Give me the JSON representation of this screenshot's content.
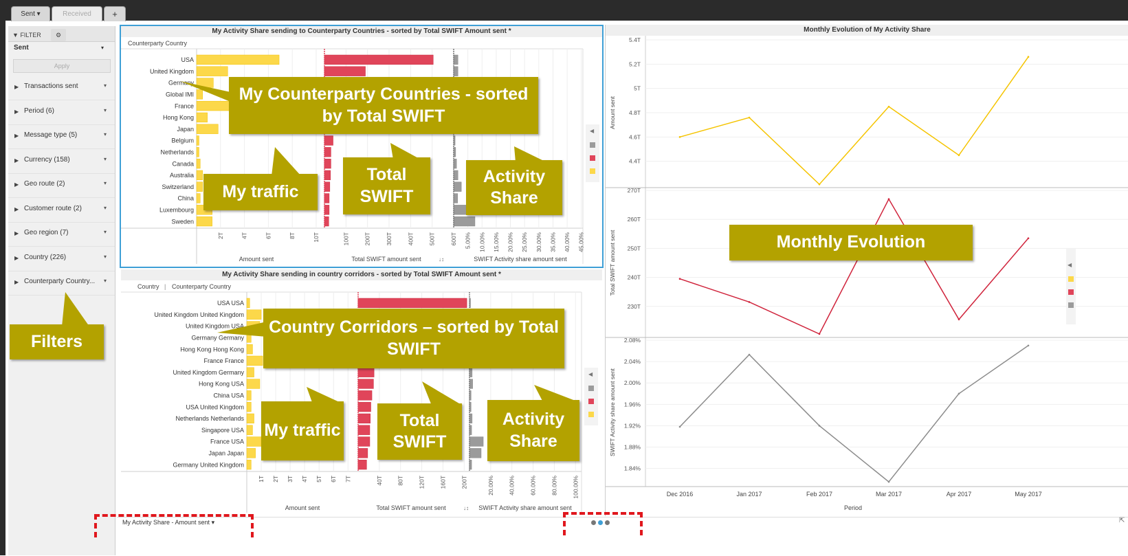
{
  "tabs": [
    {
      "label": "Sent",
      "active": true
    },
    {
      "label": "Received",
      "active": false
    }
  ],
  "add_tab_label": "+",
  "filter_panel": {
    "tab_label": "FILTER",
    "selection": "Sent",
    "apply_label": "Apply",
    "items": [
      {
        "label": "Transactions sent"
      },
      {
        "label": "Period (6)"
      },
      {
        "label": "Message type (5)"
      },
      {
        "label": "Currency (158)"
      },
      {
        "label": "Geo route (2)"
      },
      {
        "label": "Customer route (2)"
      },
      {
        "label": "Geo region (7)"
      },
      {
        "label": "Country (226)"
      },
      {
        "label": "Counterparty Country..."
      }
    ]
  },
  "colors": {
    "traffic": "#fcd84a",
    "swift": "#e0455a",
    "share": "#9b9b9b",
    "callout": "#b3a200",
    "selection_border": "#3e9fd6"
  },
  "panel_top": {
    "title": "My Activity Share sending to Counterparty Countries - sorted by Total SWIFT Amount sent *",
    "dimension_header": "Counterparty Country",
    "axis_labels": {
      "traffic": "Amount sent",
      "swift": "Total SWIFT amount sent",
      "sort_icon": "↓↕",
      "share": "SWIFT Activity share amount sent"
    }
  },
  "panel_bottom": {
    "title": "My Activity Share sending in country corridors - sorted by Total SWIFT Amount sent *",
    "dimension_header_1": "Country",
    "dimension_sep": "|",
    "dimension_header_2": "Counterparty Country",
    "axis_labels": {
      "traffic": "Amount sent",
      "swift": "Total SWIFT amount sent",
      "sort_icon": "↓↕",
      "share": "SWIFT Activity share amount sent"
    }
  },
  "panel_right": {
    "title": "Monthly Evolution of My Activity Share",
    "xlabel": "Period"
  },
  "chart_data": [
    {
      "type": "bar",
      "categories": [
        "USA",
        "United Kingdom",
        "Germany",
        "Global IMI",
        "France",
        "Hong Kong",
        "Japan",
        "Belgium",
        "Netherlands",
        "Canada",
        "Australia",
        "Switzerland",
        "China",
        "Luxembourg",
        "Sweden"
      ],
      "series": [
        {
          "name": "Amount sent",
          "values": [
            6.9,
            2.6,
            1.4,
            0.5,
            2.9,
            0.9,
            1.8,
            0.2,
            0.2,
            0.3,
            0.5,
            0.5,
            0.3,
            1.3,
            1.3
          ]
        },
        {
          "name": "Total SWIFT amount sent",
          "values": [
            505,
            190,
            150,
            130,
            115,
            100,
            90,
            40,
            30,
            30,
            28,
            25,
            22,
            22,
            20
          ]
        },
        {
          "name": "SWIFT Activity share amount sent",
          "values": [
            1.5,
            1.5,
            1.2,
            0.5,
            2.2,
            1.0,
            2.2,
            0.5,
            0.7,
            1.0,
            1.5,
            2.7,
            1.4,
            7.5,
            7.5
          ]
        }
      ],
      "traffic_ticks": [
        "2T",
        "4T",
        "6T",
        "8T",
        "10T"
      ],
      "swift_ticks": [
        "100T",
        "200T",
        "300T",
        "400T",
        "500T",
        "600T"
      ],
      "share_ticks": [
        "5.00%",
        "10.00%",
        "15.00%",
        "20.00%",
        "25.00%",
        "30.00%",
        "35.00%",
        "40.00%",
        "45.00%"
      ],
      "xlim": {
        "traffic": [
          0,
          10
        ],
        "swift": [
          0,
          600
        ],
        "share": [
          0,
          47
        ]
      }
    },
    {
      "type": "bar",
      "categories": [
        "USA USA",
        "United Kingdom United Kingdom",
        "United Kingdom USA",
        "Germany Germany",
        "Hong Kong Hong Kong",
        "France France",
        "United Kingdom Germany",
        "Hong Kong USA",
        "China USA",
        "USA United Kingdom",
        "Netherlands Netherlands",
        "Singapore USA",
        "France USA",
        "Japan Japan",
        "Germany United Kingdom"
      ],
      "series": [
        {
          "name": "Amount sent",
          "values": [
            0.2,
            1.0,
            0.9,
            0.3,
            0.4,
            1.1,
            0.5,
            0.9,
            0.3,
            0.3,
            0.5,
            0.4,
            1.0,
            0.6,
            0.3
          ]
        },
        {
          "name": "Total SWIFT amount sent",
          "values": [
            205,
            110,
            75,
            38,
            32,
            31,
            30,
            29,
            26,
            24,
            23,
            22,
            22,
            18,
            16
          ]
        },
        {
          "name": "SWIFT Activity share amount sent",
          "values": [
            0.4,
            1.0,
            1.2,
            0.8,
            1.0,
            3.5,
            2.5,
            3.0,
            1.5,
            1.5,
            2.5,
            2.0,
            13.0,
            11.0,
            2.0
          ]
        }
      ],
      "traffic_ticks": [
        "1T",
        "2T",
        "3T",
        "4T",
        "5T",
        "6T",
        "7T"
      ],
      "swift_ticks": [
        "40T",
        "80T",
        "120T",
        "160T",
        "200T"
      ],
      "share_ticks": [
        "20.00%",
        "40.00%",
        "60.00%",
        "80.00%",
        "100.00%"
      ],
      "xlim": {
        "traffic": [
          0,
          7.7
        ],
        "swift": [
          0,
          210
        ],
        "share": [
          0,
          105
        ]
      }
    },
    {
      "type": "line",
      "x": [
        "Dec 2016",
        "Jan 2017",
        "Feb 2017",
        "Mar 2017",
        "Apr 2017",
        "May 2017"
      ],
      "ylabel": "Amount sent",
      "yticks": [
        "5.4T",
        "5.2T",
        "5T",
        "4.8T",
        "4.6T",
        "4.4T"
      ],
      "ylim": [
        4.2,
        5.4
      ],
      "series": [
        {
          "values": [
            4.6,
            4.76,
            4.21,
            4.85,
            4.45,
            5.26
          ]
        }
      ]
    },
    {
      "type": "line",
      "x": [
        "Dec 2016",
        "Jan 2017",
        "Feb 2017",
        "Mar 2017",
        "Apr 2017",
        "May 2017"
      ],
      "ylabel": "Total SWIFT amount sent",
      "yticks": [
        "270T",
        "260T",
        "250T",
        "240T",
        "230T"
      ],
      "ylim": [
        220,
        270
      ],
      "series": [
        {
          "values": [
            239.5,
            231.5,
            220.5,
            267.0,
            225.5,
            253.5
          ]
        }
      ]
    },
    {
      "type": "line",
      "x": [
        "Dec 2016",
        "Jan 2017",
        "Feb 2017",
        "Mar 2017",
        "Apr 2017",
        "May 2017"
      ],
      "ylabel": "SWIFT Activity share amount sent",
      "yticks": [
        "2.08%",
        "2.04%",
        "2.00%",
        "1.96%",
        "1.92%",
        "1.88%",
        "1.84%"
      ],
      "ylim": [
        1.81,
        2.08
      ],
      "series": [
        {
          "values": [
            1.918,
            2.053,
            1.92,
            1.815,
            1.98,
            2.07
          ]
        }
      ]
    }
  ],
  "callouts": {
    "top_counterparty": "My Counterparty Countries - sorted by Total SWIFT",
    "top_traffic": "My traffic",
    "top_total": "Total SWIFT",
    "top_share": "Activity Share",
    "bottom_corridors": "Country Corridors – sorted by Total SWIFT",
    "bottom_traffic": "My traffic",
    "bottom_total": "Total SWIFT",
    "bottom_share": "Activity Share",
    "monthly": "Monthly Evolution",
    "filters": "Filters"
  },
  "footer": {
    "page_selector": "My Activity Share - Amount sent",
    "page_dots": 3,
    "active_dot": 1
  }
}
